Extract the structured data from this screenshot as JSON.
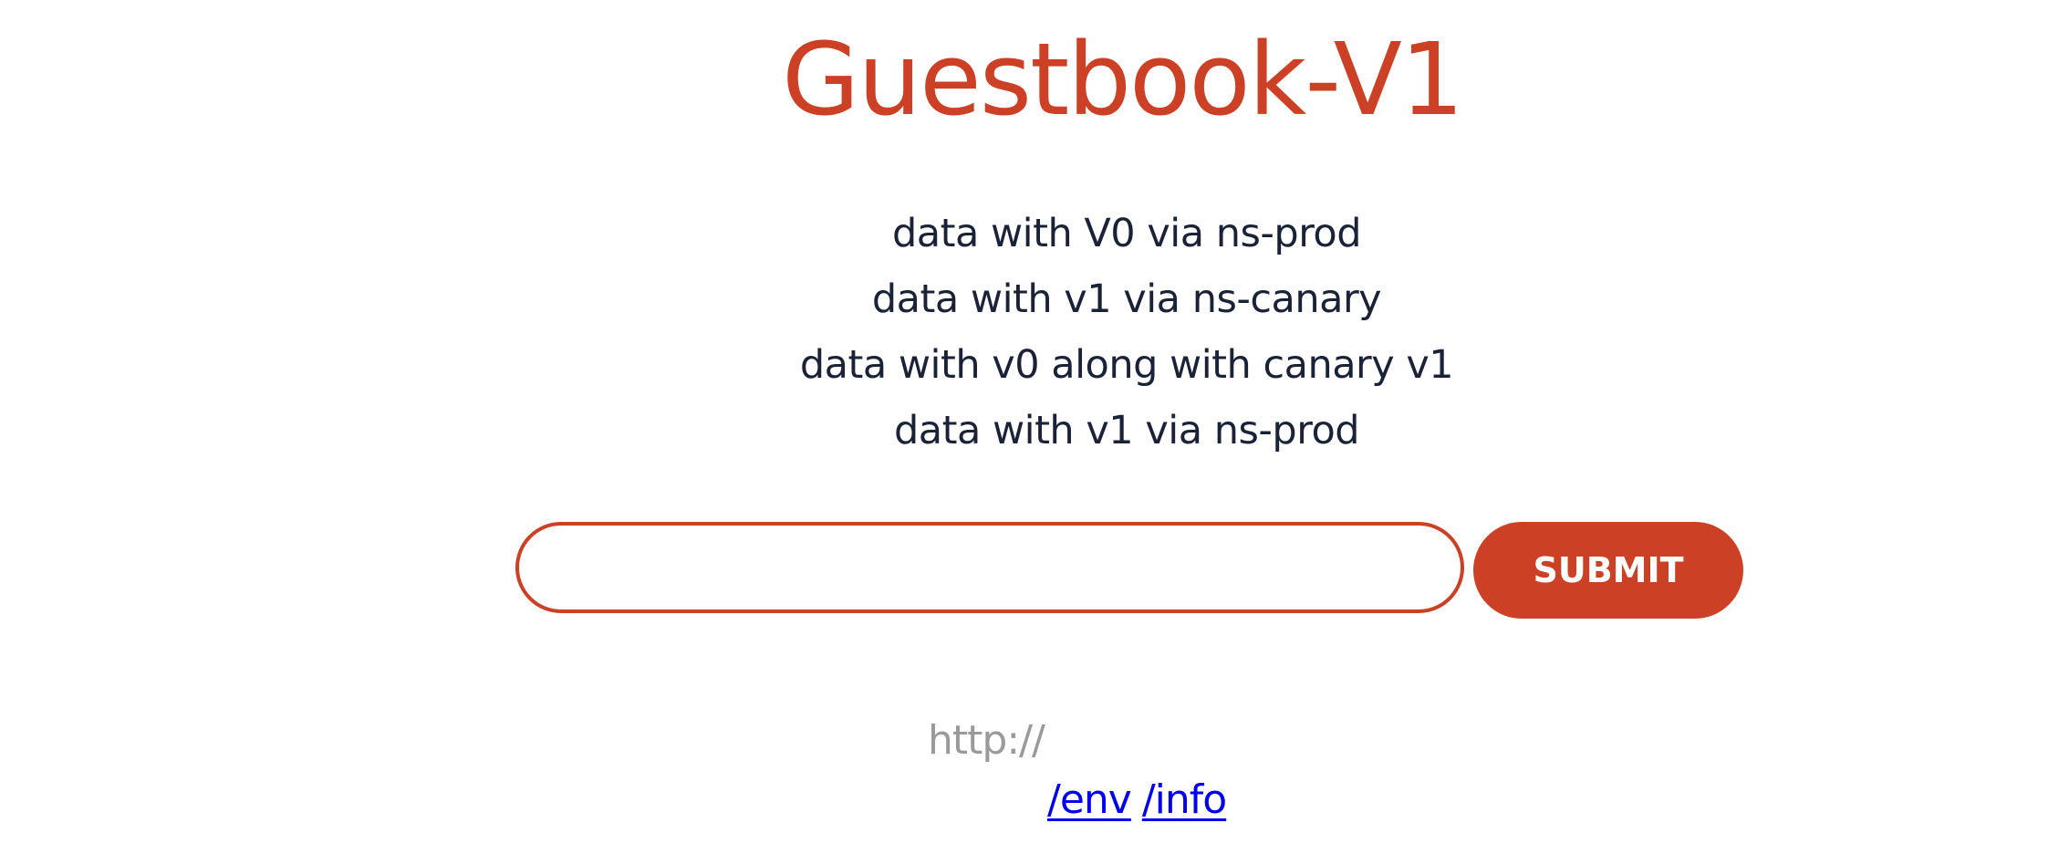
{
  "header": {
    "title": "Guestbook-V1"
  },
  "entries": [
    "data with V0 via ns-prod",
    "data with v1 via ns-canary",
    "data with v0 along with canary v1",
    "data with v1 via ns-prod"
  ],
  "form": {
    "input_value": "",
    "submit_label": "SUBMIT"
  },
  "footer": {
    "host_text": "http://",
    "links": [
      {
        "label": "/env"
      },
      {
        "label": "/info"
      }
    ]
  },
  "colors": {
    "accent": "#cc4125",
    "text": "#1a2238",
    "muted": "#9a9a9a",
    "link": "#0000ee"
  }
}
